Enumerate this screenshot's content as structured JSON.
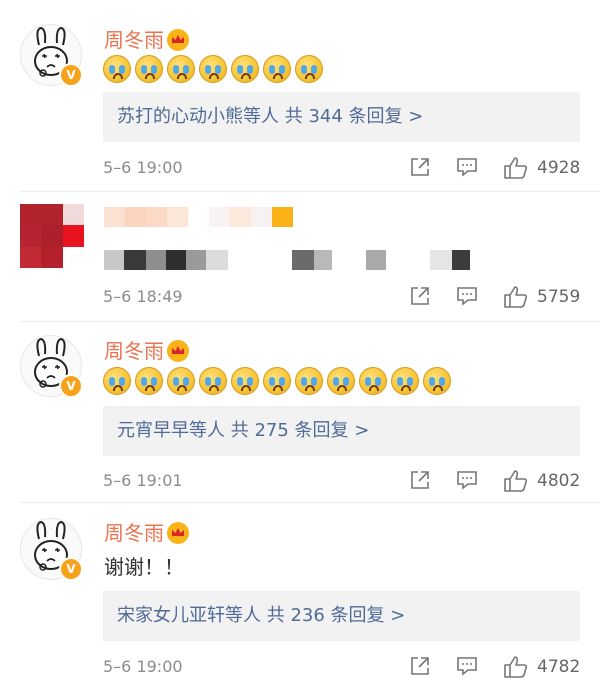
{
  "comments": [
    {
      "username": "周冬雨",
      "text": "",
      "emoji_count": 7,
      "reply_summary": "苏打的心动小熊等人  共 344 条回复 >",
      "time": "5–6 19:00",
      "likes": "4928"
    },
    {
      "username": "",
      "text": "",
      "time": "5–6 18:49",
      "likes": "5759"
    },
    {
      "username": "周冬雨",
      "text": "",
      "emoji_count": 11,
      "reply_summary": "元宵早早等人  共 275 条回复 >",
      "time": "5–6 19:01",
      "likes": "4802"
    },
    {
      "username": "周冬雨",
      "text": "谢谢！！",
      "reply_summary": "宋家女儿亚轩等人  共 236 条回复 >",
      "time": "5–6 19:00",
      "likes": "4782"
    }
  ],
  "icons": {
    "verified_badge": "V",
    "crown": "crown-icon",
    "emoji": "crying-face-icon",
    "share": "share-icon",
    "comment": "comment-icon",
    "like": "thumbs-up-icon"
  },
  "colors": {
    "username": "#eb7350",
    "link": "#506b96",
    "reply_bg": "#f2f2f2",
    "badge": "#f7a21b"
  }
}
